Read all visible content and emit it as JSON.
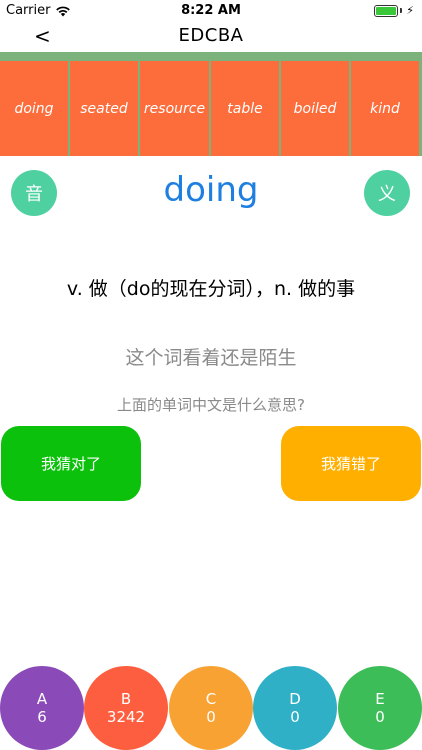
{
  "status_bar": {
    "carrier": "Carrier",
    "time": "8:22 AM",
    "battery_icon": "battery-charging-icon"
  },
  "nav": {
    "back_label": "<",
    "title": "EDCBA"
  },
  "word_strip": [
    "doing",
    "seated",
    "resource",
    "table",
    "boiled",
    "kind"
  ],
  "main": {
    "sound_label": "音",
    "meaning_label": "义",
    "word": "doing",
    "definition": "v. 做（do的现在分词），n. 做的事",
    "unfamiliar_prompt": "这个词看着还是陌生",
    "question": "上面的单词中文是什么意思?",
    "guess_right": "我猜对了",
    "guess_wrong": "我猜错了"
  },
  "grades": [
    {
      "letter": "A",
      "count": "6",
      "color": "#8a4ab8"
    },
    {
      "letter": "B",
      "count": "3242",
      "color": "#fd5e3f"
    },
    {
      "letter": "C",
      "count": "0",
      "color": "#f8a233"
    },
    {
      "letter": "D",
      "count": "0",
      "color": "#2fb0c6"
    },
    {
      "letter": "E",
      "count": "0",
      "color": "#3dbd57"
    }
  ],
  "colors": {
    "strip_bg": "#7cb37c",
    "card_bg": "#fd6d3c",
    "accent_word": "#1e7fe0",
    "circle_btn": "#4fd0a1",
    "right_btn": "#0bc10b",
    "wrong_btn": "#ffaf00"
  }
}
